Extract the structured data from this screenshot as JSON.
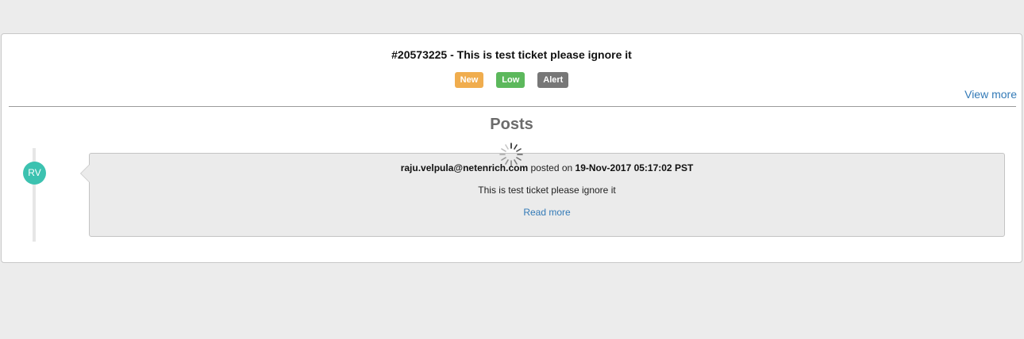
{
  "ticket": {
    "title": "#20573225 - This is test ticket please ignore it",
    "badges": [
      {
        "label": "New",
        "color": "#f0ad4e"
      },
      {
        "label": "Low",
        "color": "#5cb85c"
      },
      {
        "label": "Alert",
        "color": "#777777"
      }
    ],
    "view_more": "View more"
  },
  "posts": {
    "heading": "Posts",
    "items": [
      {
        "avatar_initials": "RV",
        "author": "raju.velpula@netenrich.com",
        "posted_on_text": "posted on",
        "timestamp": "19-Nov-2017 05:17:02 PST",
        "body": "This is test ticket please ignore it",
        "read_more": "Read more"
      }
    ]
  },
  "colors": {
    "avatar": "#3cc2b0",
    "link": "#337ab7"
  },
  "loading_indicator": "spinner-icon"
}
